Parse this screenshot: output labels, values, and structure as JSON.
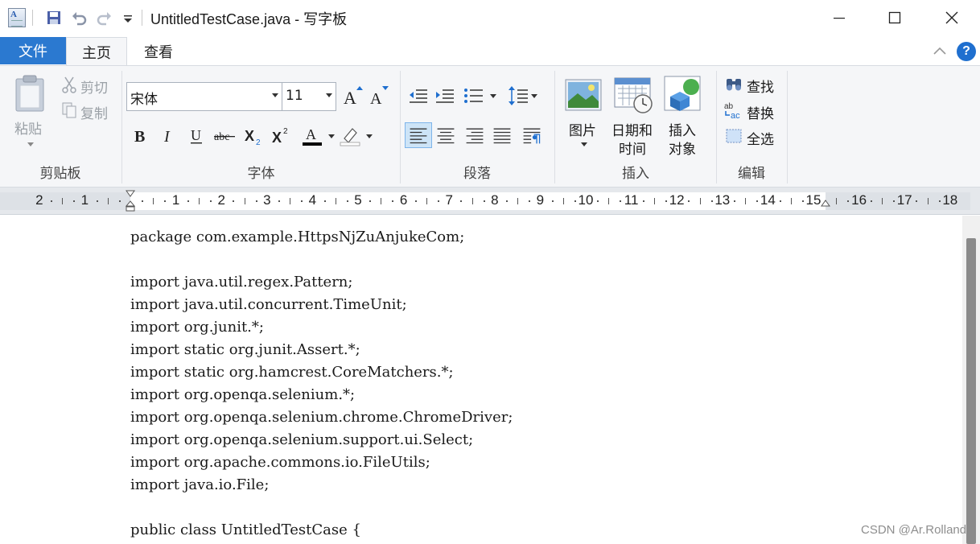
{
  "window": {
    "title": "UntitledTestCase.java - 写字板",
    "controls": [
      "minimize-icon",
      "maximize-icon",
      "close-icon"
    ]
  },
  "quick_access": {
    "icons": [
      "save-icon",
      "undo-icon",
      "redo-icon",
      "customize-dropdown-icon"
    ]
  },
  "tabs": [
    {
      "label": "文件"
    },
    {
      "label": "主页"
    },
    {
      "label": "查看"
    }
  ],
  "ribbon": {
    "clipboard": {
      "group_label": "剪贴板",
      "paste_label": "粘贴",
      "cut_label": "剪切",
      "copy_label": "复制"
    },
    "font": {
      "group_label": "字体",
      "font_family": "宋体",
      "font_size": "11",
      "buttons": [
        "grow-font",
        "shrink-font",
        "bold",
        "italic",
        "underline",
        "strikethrough",
        "subscript",
        "superscript",
        "font-color",
        "highlight-color"
      ]
    },
    "paragraph": {
      "group_label": "段落",
      "buttons": [
        "decrease-indent",
        "increase-indent",
        "bullets",
        "line-spacing",
        "align-left",
        "align-center",
        "align-right",
        "justify",
        "paragraph"
      ]
    },
    "insert": {
      "group_label": "插入",
      "picture_label": "图片",
      "datetime_label_1": "日期和",
      "datetime_label_2": "时间",
      "object_label_1": "插入",
      "object_label_2": "对象"
    },
    "edit": {
      "group_label": "编辑",
      "find_label": "查找",
      "replace_label": "替换",
      "select_all_label": "全选"
    }
  },
  "ruler": {
    "labels": [
      "2",
      "1",
      "1",
      "2",
      "3",
      "4",
      "5",
      "6",
      "7",
      "8",
      "9",
      "10",
      "11",
      "12",
      "13",
      "14",
      "15",
      "16",
      "17",
      "18"
    ]
  },
  "document": {
    "lines": [
      "package com.example.HttpsNjZuAnjukeCom;",
      "",
      "import java.util.regex.Pattern;",
      "import java.util.concurrent.TimeUnit;",
      "import org.junit.*;",
      "import static org.junit.Assert.*;",
      "import static org.hamcrest.CoreMatchers.*;",
      "import org.openqa.selenium.*;",
      "import org.openqa.selenium.chrome.ChromeDriver;",
      "import org.openqa.selenium.support.ui.Select;",
      "import org.apache.commons.io.FileUtils;",
      "import java.io.File;",
      "",
      "public class UntitledTestCase {"
    ]
  },
  "watermark": "CSDN @Ar.Rolland"
}
